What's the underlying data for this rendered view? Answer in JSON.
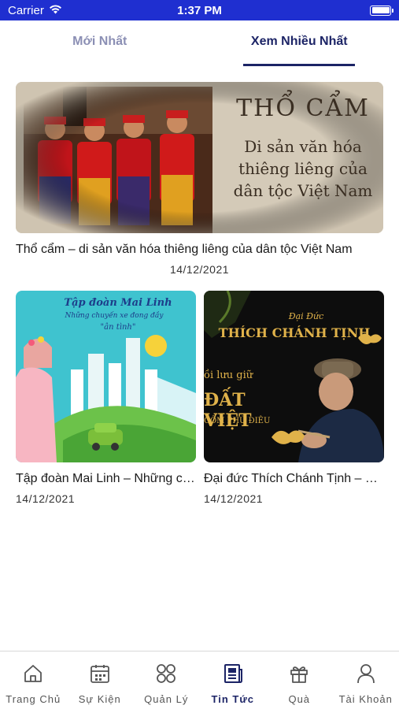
{
  "status_bar": {
    "carrier": "Carrier",
    "time": "1:37 PM"
  },
  "tabs": [
    {
      "label": "Mới Nhất",
      "active": false
    },
    {
      "label": "Xem Nhiều Nhất",
      "active": true
    }
  ],
  "featured": {
    "image_heading": "THỔ CẨM",
    "image_line1": "Di sản văn hóa",
    "image_line2": "thiêng liêng của",
    "image_line3": "dân tộc Việt Nam",
    "title": "Thổ cẩm – di sản văn hóa thiêng liêng của dân tộc Việt Nam",
    "date": "14/12/2021"
  },
  "articles": [
    {
      "image_line1": "Tập đoàn Mai Linh",
      "image_line2": "Những chuyến xe đong đầy",
      "image_line3": "\"ân tình\"",
      "title": "Tập đoàn Mai Linh – Những chuyến xe đong đầy ân tình",
      "date": "14/12/2021"
    },
    {
      "image_line1": "Đại Đức",
      "image_line2": "THÍCH CHÁNH TỊNH",
      "image_line3": "ồi lưu giữ",
      "image_line4": "ĐẤT VIỆT",
      "image_line5": "GỐM PHÙ ĐIÊU",
      "title": "Đại đức Thích Chánh Tịnh – Người lưu giữ đất Việt",
      "date": "14/12/2021"
    }
  ],
  "bottom_nav": [
    {
      "label": "Trang Chủ",
      "icon": "home-icon"
    },
    {
      "label": "Sự Kiện",
      "icon": "calendar-icon"
    },
    {
      "label": "Quản Lý",
      "icon": "grid-icon"
    },
    {
      "label": "Tin Tức",
      "icon": "news-icon",
      "active": true
    },
    {
      "label": "Quà",
      "icon": "gift-icon"
    },
    {
      "label": "Tài Khoản",
      "icon": "user-icon"
    }
  ],
  "colors": {
    "status_bar": "#1f2fd0",
    "active": "#1c2466",
    "inactive_tab": "#8b8fb4"
  }
}
